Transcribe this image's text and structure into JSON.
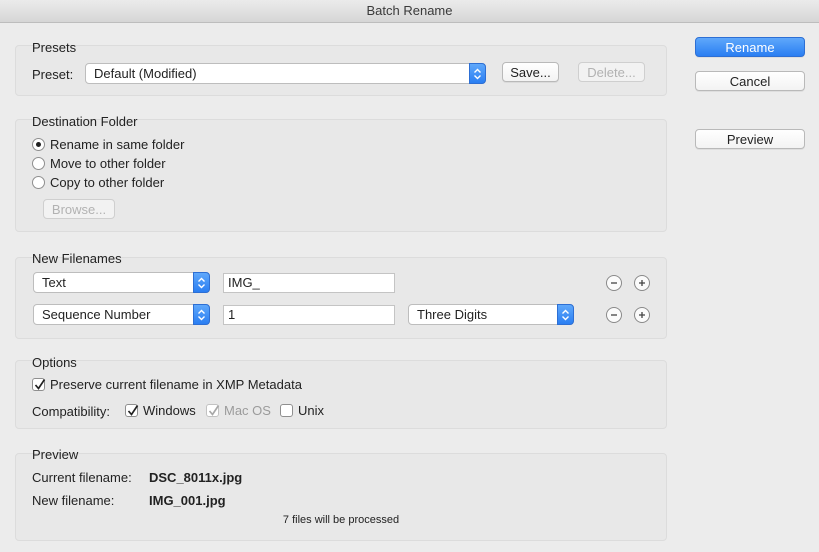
{
  "window": {
    "title": "Batch Rename"
  },
  "actions": {
    "rename": "Rename",
    "cancel": "Cancel",
    "preview": "Preview"
  },
  "presets": {
    "title": "Presets",
    "label": "Preset:",
    "value": "Default (Modified)",
    "save": "Save...",
    "delete": "Delete..."
  },
  "destination": {
    "title": "Destination Folder",
    "options": [
      "Rename in same folder",
      "Move to other folder",
      "Copy to other folder"
    ],
    "selected": "Rename in same folder",
    "browse": "Browse..."
  },
  "new_filenames": {
    "title": "New Filenames",
    "rows": [
      {
        "type": "Text",
        "value": "IMG_"
      },
      {
        "type": "Sequence Number",
        "value": "1",
        "digits": "Three Digits"
      }
    ]
  },
  "options": {
    "title": "Options",
    "preserve": "Preserve current filename in XMP Metadata",
    "preserve_checked": true,
    "compat_label": "Compatibility:",
    "compat": [
      {
        "label": "Windows",
        "checked": true,
        "disabled": false
      },
      {
        "label": "Mac OS",
        "checked": true,
        "disabled": true
      },
      {
        "label": "Unix",
        "checked": false,
        "disabled": false
      }
    ]
  },
  "preview": {
    "title": "Preview",
    "current_label": "Current filename:",
    "current_value": "DSC_8011x.jpg",
    "new_label": "New filename:",
    "new_value": "IMG_001.jpg",
    "summary": "7 files will be processed"
  }
}
